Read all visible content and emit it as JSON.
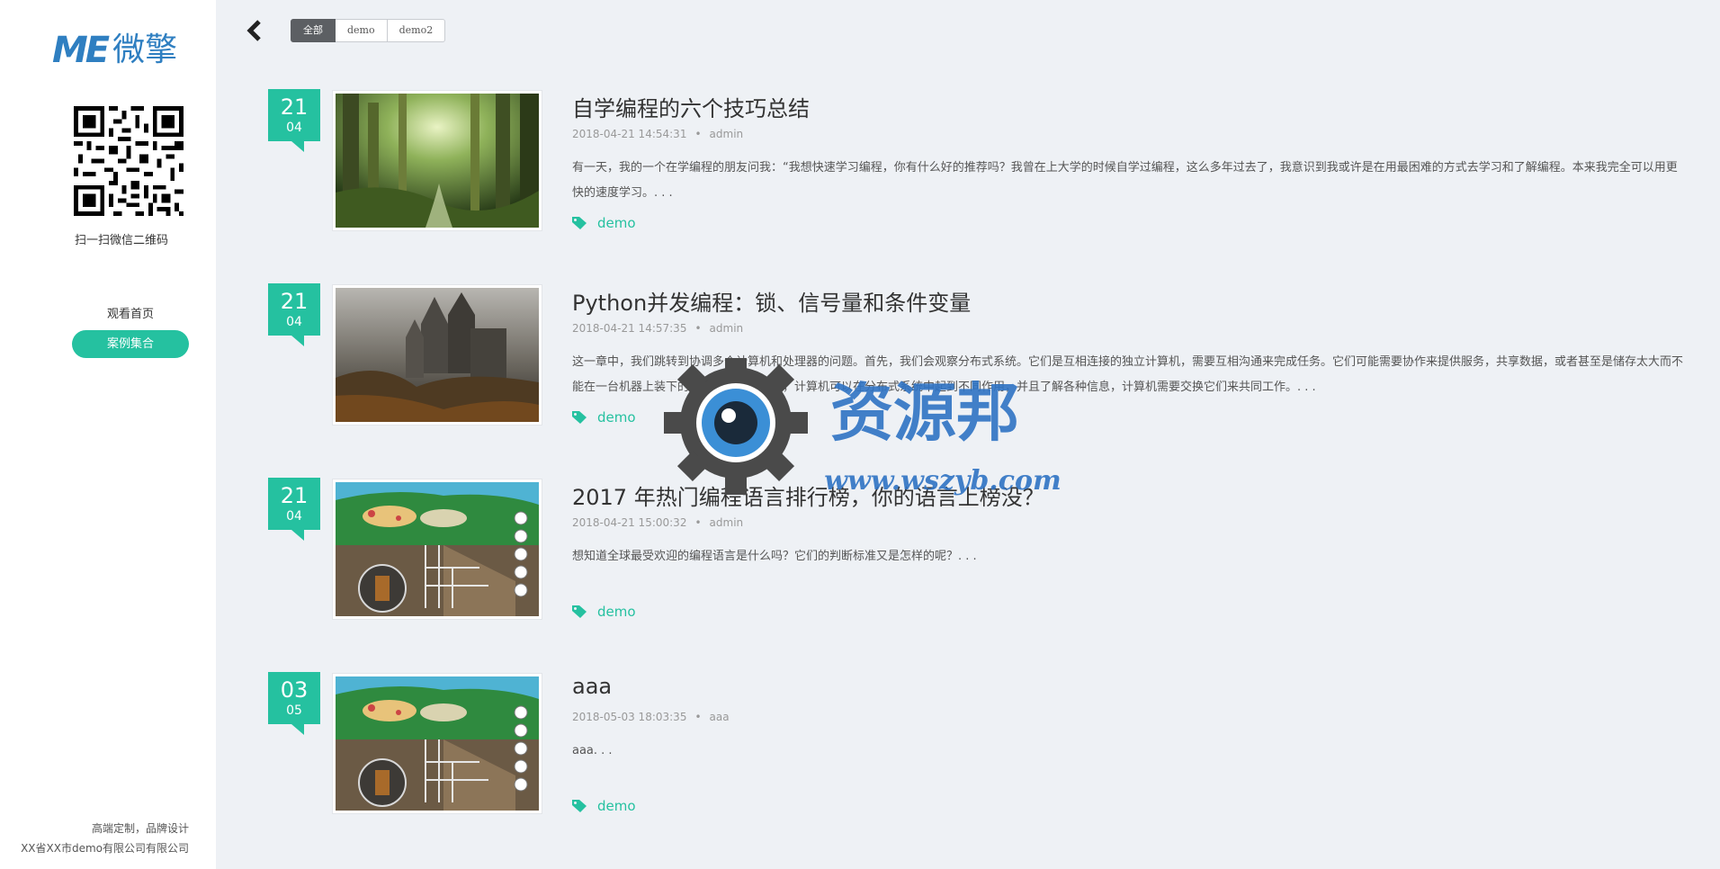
{
  "sidebar": {
    "logo_mark": "ME",
    "logo_brand": "微擎",
    "qr_caption": "扫一扫微信二维码",
    "nav_home": "观看首页",
    "nav_cases": "案例集合",
    "footer_line1": "高端定制，品牌设计",
    "footer_line2": "XX省XX市demo有限公司有限公司"
  },
  "filters": [
    "全部",
    "demo",
    "demo2"
  ],
  "active_filter": "全部",
  "posts": [
    {
      "day": "21",
      "month": "04",
      "title": "自学编程的六个技巧总结",
      "datetime": "2018-04-21 14:54:31",
      "author": "admin",
      "excerpt": "有一天，我的一个在学编程的朋友问我：“我想快速学习编程，你有什么好的推荐吗？我曾在上大学的时候自学过编程，这么多年过去了，我意识到我或许是在用最困难的方式去学习和了解编程。本来我完全可以用更快的速度学习。. . .",
      "tag": "demo",
      "image": "forest"
    },
    {
      "day": "21",
      "month": "04",
      "title": "Python并发编程：锁、信号量和条件变量",
      "datetime": "2018-04-21 14:57:35",
      "author": "admin",
      "excerpt": "这一章中，我们跳转到协调多个计算机和处理器的问题。首先，我们会观察分布式系统。它们是互相连接的独立计算机，需要互相沟通来完成任务。它们可能需要协作来提供服务，共享数据，或者甚至是储存太大而不能在一台机器上装下的数据。我们会看到，计算机可以在分布式系统中起到不同作用，并且了解各种信息，计算机需要交换它们来共同工作。. . .",
      "tag": "demo",
      "image": "castle"
    },
    {
      "day": "21",
      "month": "04",
      "title": "2017 年热门编程语言排行榜，你的语言上榜没？",
      "datetime": "2018-04-21 15:00:32",
      "author": "admin",
      "excerpt": "想知道全球最受欢迎的编程语言是什么吗？它们的判断标准又是怎样的呢？. . .",
      "tag": "demo",
      "image": "illustration"
    },
    {
      "day": "03",
      "month": "05",
      "title": "aaa",
      "datetime": "2018-05-03 18:03:35",
      "author": "aaa",
      "excerpt": "aaa. . .",
      "tag": "demo",
      "image": "illustration"
    }
  ],
  "watermark": {
    "text": "资源邦",
    "url": "www.wszyb.com"
  },
  "colors": {
    "accent": "#25c1a0",
    "logo": "#2f7fc1",
    "page_bg": "#eef1f5"
  }
}
